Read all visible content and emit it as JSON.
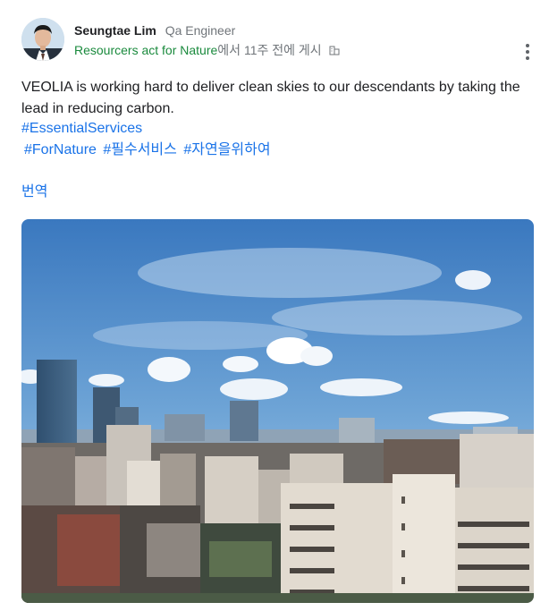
{
  "post": {
    "author_name": "Seungtae Lim",
    "author_role": "Qa Engineer",
    "community": "Resourcers act for Nature",
    "meta_suffix": "에서 11주 전에 게시",
    "body": "VEOLIA is working hard to deliver clean skies to our descendants by taking the lead in reducing carbon.",
    "hashtags_line1": "#EssentialServices",
    "hashtags_line2": [
      "#ForNature",
      "#필수서비스",
      "#자연을위하여"
    ],
    "translate_label": "번역"
  },
  "icons": {
    "more": "more-vert-icon",
    "community": "building-icon"
  },
  "colors": {
    "community_green": "#1a8a3d",
    "link_blue": "#1a73e8",
    "muted": "#70757a"
  }
}
